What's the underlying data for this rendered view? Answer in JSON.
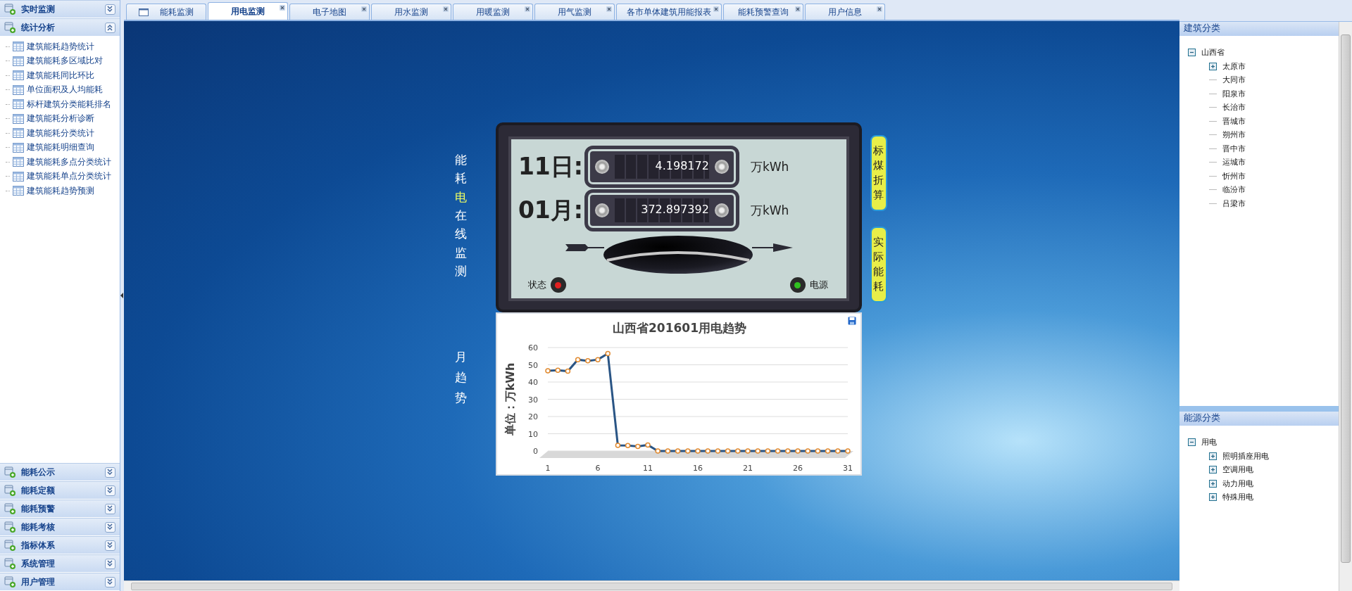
{
  "sidebar": {
    "sections": [
      {
        "label": "实时监测",
        "expanded": false
      },
      {
        "label": "统计分析",
        "expanded": true,
        "items": [
          "建筑能耗趋势统计",
          "建筑能耗多区域比对",
          "建筑能耗同比环比",
          "单位面积及人均能耗",
          "标杆建筑分类能耗排名",
          "建筑能耗分析诊断",
          "建筑能耗分类统计",
          "建筑能耗明细查询",
          "建筑能耗多点分类统计",
          "建筑能耗单点分类统计",
          "建筑能耗趋势预测"
        ]
      },
      {
        "label": "能耗公示",
        "expanded": false
      },
      {
        "label": "能耗定额",
        "expanded": false
      },
      {
        "label": "能耗预警",
        "expanded": false
      },
      {
        "label": "能耗考核",
        "expanded": false
      },
      {
        "label": "指标体系",
        "expanded": false
      },
      {
        "label": "系统管理",
        "expanded": false
      },
      {
        "label": "用户管理",
        "expanded": false
      }
    ]
  },
  "tabs": [
    {
      "label": "能耗监测",
      "selected": false,
      "closable": false
    },
    {
      "label": "用电监测",
      "selected": true,
      "closable": true
    },
    {
      "label": "电子地图",
      "selected": false,
      "closable": true
    },
    {
      "label": "用水监测",
      "selected": false,
      "closable": true
    },
    {
      "label": "用暖监测",
      "selected": false,
      "closable": true
    },
    {
      "label": "用气监测",
      "selected": false,
      "closable": true
    },
    {
      "label": "各市单体建筑用能报表",
      "selected": false,
      "closable": true
    },
    {
      "label": "能耗预警查询",
      "selected": false,
      "closable": true
    },
    {
      "label": "用户信息",
      "selected": false,
      "closable": true
    }
  ],
  "side_title": {
    "parts": [
      {
        "text": "能耗",
        "highlight": false
      },
      {
        "text": "电",
        "highlight": true
      },
      {
        "text": "在线监测",
        "highlight": false
      }
    ]
  },
  "side_subtitle": "月趋势",
  "meter": {
    "rows": [
      {
        "label": "11日:",
        "value": "4.198172",
        "unit": "万kWh"
      },
      {
        "label": "01月:",
        "value": "372.897392",
        "unit": "万kWh"
      }
    ],
    "indicators": [
      {
        "label": "状态",
        "color": "#e02020"
      },
      {
        "label": "电源",
        "color": "#30c020"
      }
    ]
  },
  "meter_buttons": [
    "标煤折算",
    "实际能耗"
  ],
  "chart": {
    "chart_data": {
      "type": "line",
      "title": "山西省201601用电趋势",
      "ylabel": "单位：万kWh",
      "x": [
        1,
        2,
        3,
        4,
        5,
        6,
        7,
        8,
        9,
        10,
        11,
        12,
        13,
        14,
        15,
        16,
        17,
        18,
        19,
        20,
        21,
        22,
        23,
        24,
        25,
        26,
        27,
        28,
        29,
        30,
        31
      ],
      "series": [
        {
          "color": "#2a5585",
          "marker": true,
          "values": [
            46.5,
            46.8,
            46.3,
            53,
            52.3,
            53,
            56.5,
            3.3,
            3.2,
            2.7,
            3.5,
            0,
            0,
            0,
            0,
            0,
            0,
            0,
            0,
            0,
            0,
            0,
            0,
            0,
            0,
            0,
            0,
            0,
            0,
            0,
            0
          ]
        }
      ],
      "xlim": [
        1,
        31
      ],
      "ylim": [
        0,
        60
      ],
      "grid": true,
      "xticks": [
        1,
        6,
        11,
        16,
        21,
        26,
        31
      ],
      "yticks": [
        0,
        10,
        20,
        30,
        40,
        50,
        60
      ]
    }
  },
  "building_panel": {
    "title": "建筑分类",
    "tree": [
      {
        "label": "山西省",
        "kind": "branch",
        "expanded": true,
        "children": [
          {
            "label": "太原市",
            "kind": "branch",
            "expanded": false
          },
          {
            "label": "大同市",
            "kind": "leaf"
          },
          {
            "label": "阳泉市",
            "kind": "leaf"
          },
          {
            "label": "长治市",
            "kind": "leaf"
          },
          {
            "label": "晋城市",
            "kind": "leaf"
          },
          {
            "label": "朔州市",
            "kind": "leaf"
          },
          {
            "label": "晋中市",
            "kind": "leaf"
          },
          {
            "label": "运城市",
            "kind": "leaf"
          },
          {
            "label": "忻州市",
            "kind": "leaf"
          },
          {
            "label": "临汾市",
            "kind": "leaf"
          },
          {
            "label": "吕梁市",
            "kind": "leaf"
          }
        ]
      }
    ]
  },
  "energy_panel": {
    "title": "能源分类",
    "tree": [
      {
        "label": "用电",
        "kind": "branch",
        "expanded": true,
        "children": [
          {
            "label": "照明插座用电",
            "kind": "branch",
            "expanded": false
          },
          {
            "label": "空调用电",
            "kind": "branch",
            "expanded": false
          },
          {
            "label": "动力用电",
            "kind": "branch",
            "expanded": false
          },
          {
            "label": "特殊用电",
            "kind": "branch",
            "expanded": false
          }
        ]
      }
    ]
  }
}
